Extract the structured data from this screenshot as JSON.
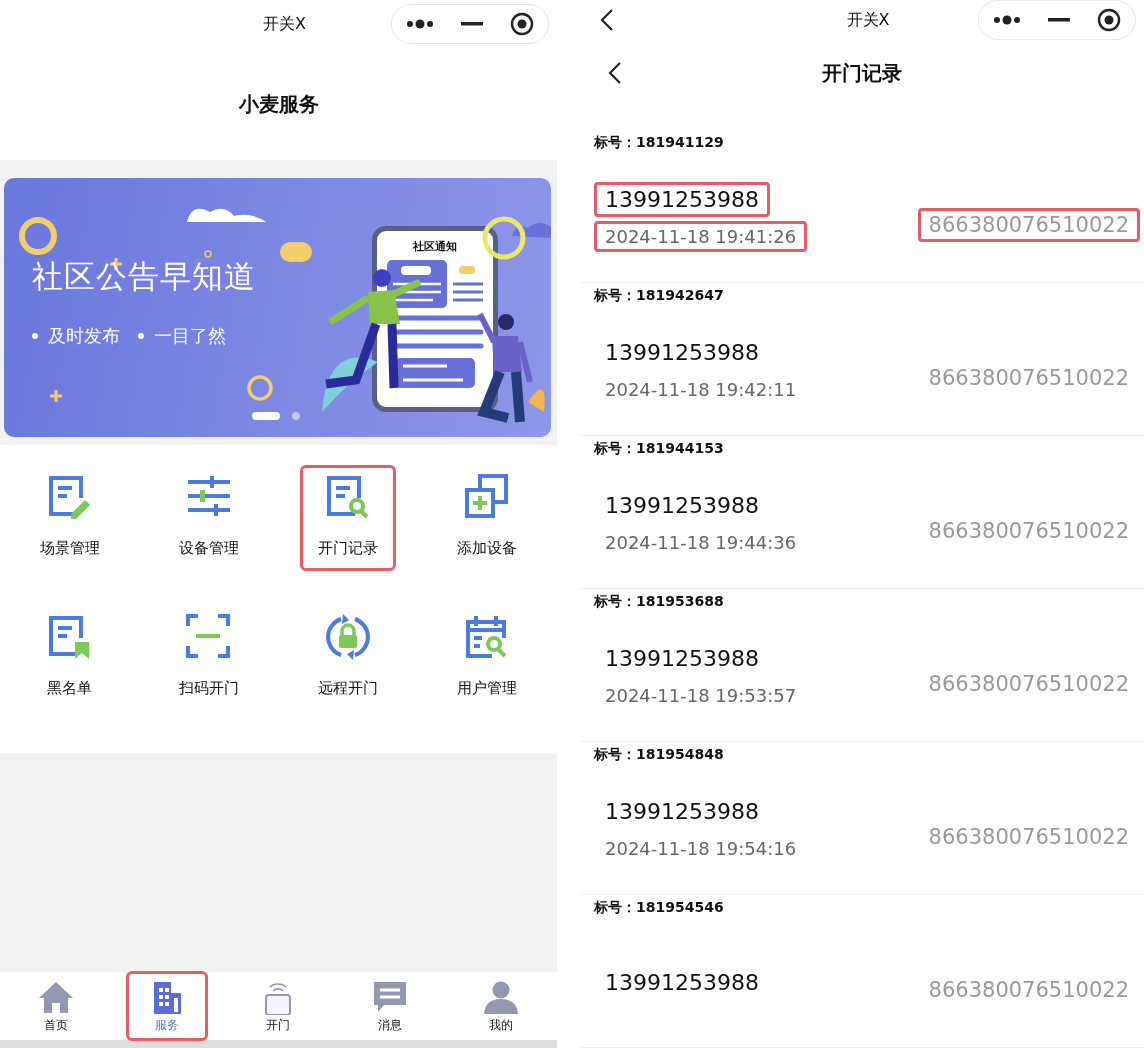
{
  "left_screen": {
    "window_title": "开关X",
    "page_title": "小麦服务",
    "banner": {
      "title": "社区公告早知道",
      "bullets": [
        "及时发布",
        "一目了然"
      ],
      "card_title": "社区通知",
      "pages": [
        {
          "selected": true
        },
        {
          "selected": false
        }
      ]
    },
    "services": [
      {
        "label": "场景管理",
        "highlighted": false
      },
      {
        "label": "设备管理",
        "highlighted": false
      },
      {
        "label": "开门记录",
        "highlighted": true
      },
      {
        "label": "添加设备",
        "highlighted": false
      },
      {
        "label": "黑名单",
        "highlighted": false
      },
      {
        "label": "扫码开门",
        "highlighted": false
      },
      {
        "label": "远程开门",
        "highlighted": false
      },
      {
        "label": "用户管理",
        "highlighted": false
      }
    ],
    "tab_bar": [
      {
        "label": "首页",
        "selected": false,
        "highlighted": false
      },
      {
        "label": "服务",
        "selected": true,
        "highlighted": true
      },
      {
        "label": "开门",
        "selected": false,
        "highlighted": false
      },
      {
        "label": "消息",
        "selected": false,
        "highlighted": false
      },
      {
        "label": "我的",
        "selected": false,
        "highlighted": false
      }
    ]
  },
  "right_screen": {
    "window_title": "开关X",
    "page_title": "开门记录",
    "records": [
      {
        "number": "标号：181941129",
        "phone": "13991253988",
        "time": "2024-11-18 19:41:26",
        "device": "866380076510022",
        "highlighted": true
      },
      {
        "number": "标号：181942647",
        "phone": "13991253988",
        "time": "2024-11-18 19:42:11",
        "device": "866380076510022",
        "highlighted": false
      },
      {
        "number": "标号：181944153",
        "phone": "13991253988",
        "time": "2024-11-18 19:44:36",
        "device": "866380076510022",
        "highlighted": false
      },
      {
        "number": "标号：181953688",
        "phone": "13991253988",
        "time": "2024-11-18 19:53:57",
        "device": "866380076510022",
        "highlighted": false
      },
      {
        "number": "标号：181954848",
        "phone": "13991253988",
        "time": "2024-11-18 19:54:16",
        "device": "866380076510022",
        "highlighted": false
      },
      {
        "number": "标号：181954546",
        "phone": "13991253988",
        "device": "866380076510022",
        "highlighted": false
      }
    ]
  }
}
